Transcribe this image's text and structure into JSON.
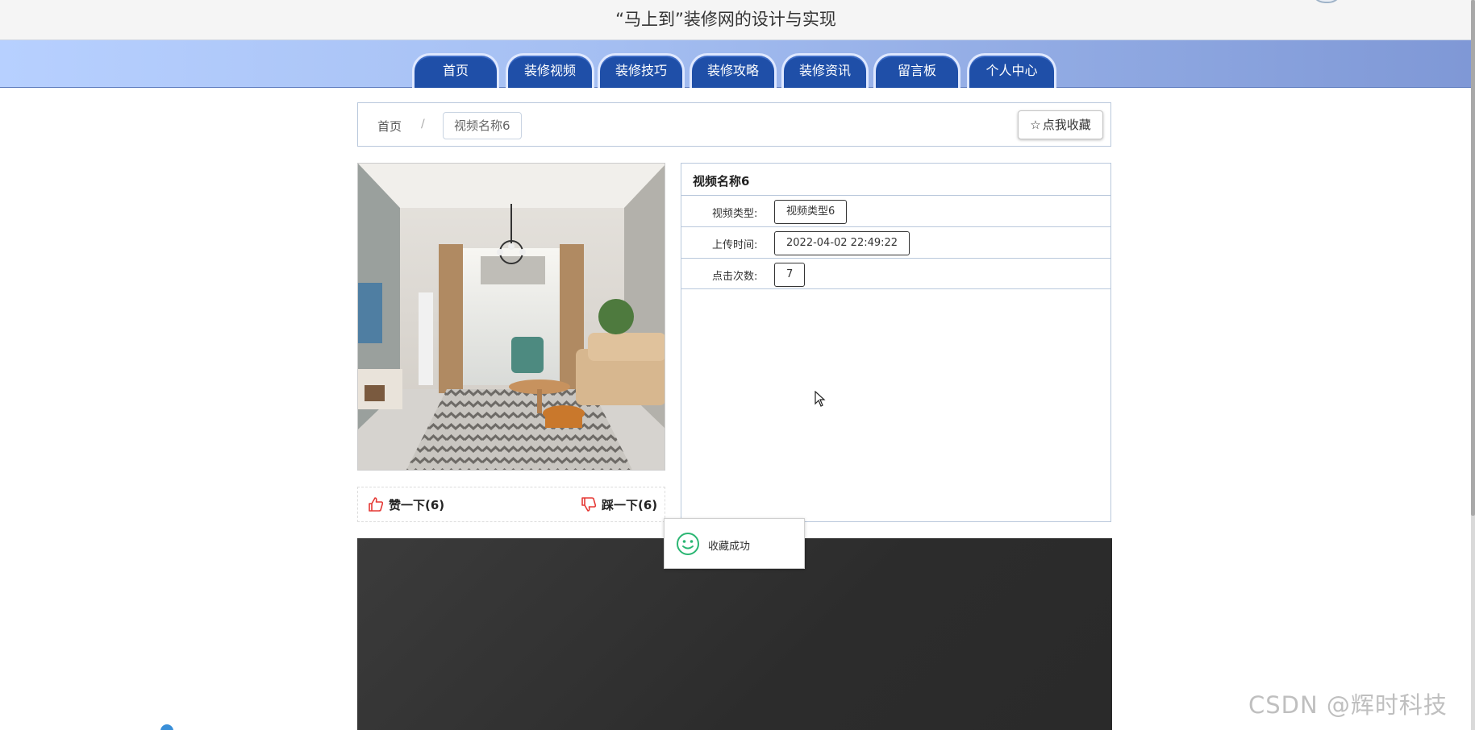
{
  "header": {
    "title": "“马上到”装修网的设计与实现"
  },
  "nav": {
    "items": [
      {
        "label": "首页"
      },
      {
        "label": "装修视频"
      },
      {
        "label": "装修技巧"
      },
      {
        "label": "装修攻略"
      },
      {
        "label": "装修资讯"
      },
      {
        "label": "留言板"
      },
      {
        "label": "个人中心"
      }
    ]
  },
  "breadcrumb": {
    "home": "首页",
    "separator": "/",
    "current": "视频名称6"
  },
  "favorite": {
    "label": "点我收藏",
    "icon": "star-outline-icon"
  },
  "video": {
    "title": "视频名称6",
    "fields": [
      {
        "label": "视频类型:",
        "value": "视频类型6"
      },
      {
        "label": "上传时间:",
        "value": "2022-04-02 22:49:22"
      },
      {
        "label": "点击次数:",
        "value": "7"
      }
    ]
  },
  "votes": {
    "up_label": "赞一下(6)",
    "down_label": "踩一下(6)",
    "up_icon": "thumbs-up-icon",
    "down_icon": "thumbs-down-icon",
    "icon_color": "#e53935"
  },
  "toast": {
    "text": "收藏成功",
    "icon": "smile-icon",
    "icon_color": "#2bb673"
  },
  "watermark": "CSDN @辉时科技",
  "colors": {
    "nav_tab": "#1f4fa8",
    "panel_border": "#b9c8dc",
    "video_bg": "#2e2e2e"
  }
}
